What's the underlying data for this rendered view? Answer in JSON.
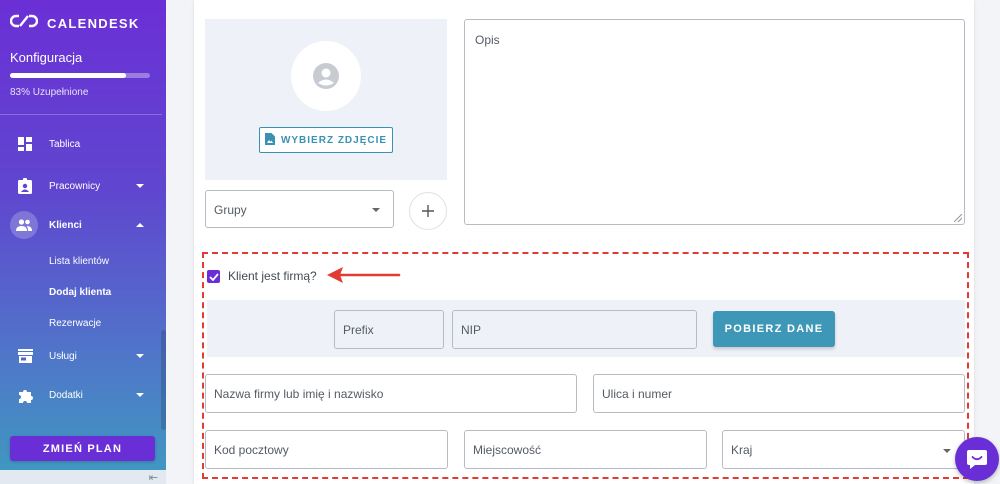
{
  "brand": {
    "name": "CALENDESK"
  },
  "setup": {
    "title": "Konfiguracja",
    "progress_value": 0.83,
    "progress_text": "83% Uzupełnione"
  },
  "sidebar": {
    "items": [
      {
        "label": "Tablica",
        "icon": "dashboard-icon"
      },
      {
        "label": "Pracownicy",
        "icon": "badge-icon"
      },
      {
        "label": "Klienci",
        "icon": "people-icon"
      },
      {
        "label": "Usługi",
        "icon": "store-icon"
      },
      {
        "label": "Dodatki",
        "icon": "puzzle-icon"
      }
    ],
    "client_subitems": [
      "Lista klientów",
      "Dodaj klienta",
      "Rezerwacje"
    ],
    "plan_button": "ZMIEŃ PLAN"
  },
  "form": {
    "choose_photo_label": "WYBIERZ ZDJĘCIE",
    "description_placeholder": "Opis",
    "groups_placeholder": "Grupy",
    "is_company_label": "Klient jest firmą?",
    "is_company_checked": true,
    "prefix_placeholder": "Prefix",
    "nip_placeholder": "NIP",
    "fetch_data_button": "POBIERZ DANE",
    "company_name_placeholder": "Nazwa firmy lub imię i nazwisko",
    "street_placeholder": "Ulica i numer",
    "postal_code_placeholder": "Kod pocztowy",
    "city_placeholder": "Miejscowość",
    "country_placeholder": "Kraj"
  },
  "colors": {
    "accent_purple": "#6a2ed6",
    "accent_teal": "#3e97b6",
    "highlight_red": "#e23b33"
  }
}
